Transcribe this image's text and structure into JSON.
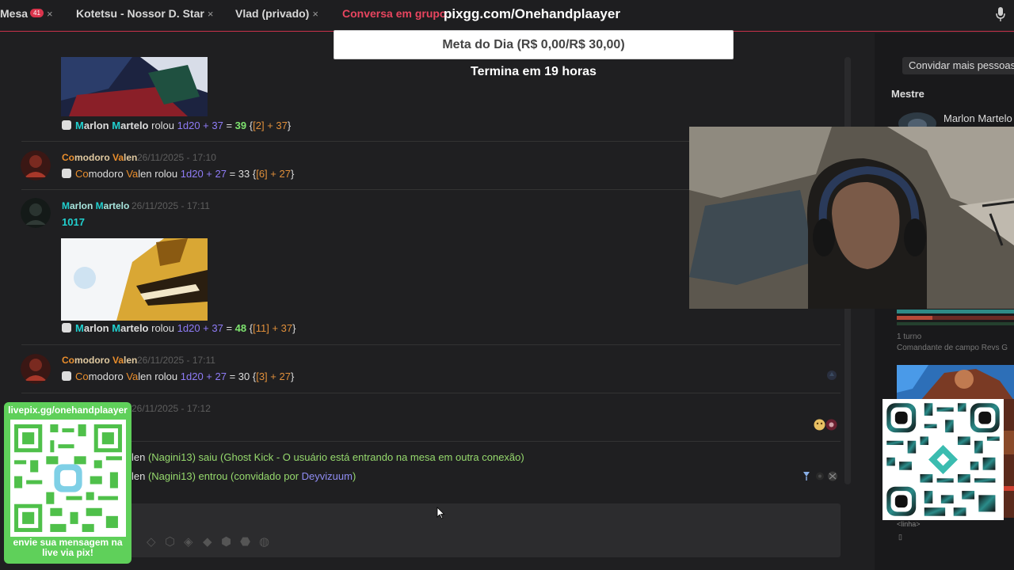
{
  "tabs": [
    {
      "label": "Mesa",
      "badge": "41",
      "close": "×"
    },
    {
      "label": "Kotetsu - Nossor D. Star",
      "close": "×"
    },
    {
      "label": "Vlad (privado)",
      "close": "×"
    },
    {
      "label": "Conversa em grupo",
      "close": ""
    }
  ],
  "overlay": {
    "pix_url": "pixgg.com/Onehandplaayer",
    "goal": "Meta do Dia (R$ 0,00/R$ 30,00)",
    "goal_ends": "Termina em 19 horas"
  },
  "messages": {
    "m1": {
      "roll_user_a": "M",
      "roll_user_b": "arlon ",
      "roll_user_c": "M",
      "roll_user_d": "artelo",
      "rolled": " rolou ",
      "dice": "1d20 + 37",
      "eq": " = ",
      "result": "39",
      "brace_open": " {",
      "bracket": "[2]",
      "plus": " + 37",
      "brace_close": "}"
    },
    "m2": {
      "user_a": "Co",
      "user_b": "modoro ",
      "user_c": "Va",
      "user_d": "len",
      "timestamp": "26/11/2025 - 17:10",
      "dice": "1d20 + 27",
      "eq": " = 33 {",
      "bracket": "[6]",
      "plus": " + 27",
      "brace_close": "}"
    },
    "m3": {
      "user_a": "M",
      "user_b": "arlon ",
      "user_c": "M",
      "user_d": "artelo",
      "timestamp": "26/11/2025 - 17:11",
      "text": "1017",
      "dice": "1d20 + 37",
      "eq": " = ",
      "result": "48",
      "brace_open": " {",
      "bracket": "[11]",
      "plus": " + 37",
      "brace_close": "}"
    },
    "m4": {
      "user_a": "Co",
      "user_b": "modoro ",
      "user_c": "Va",
      "user_d": "len",
      "timestamp": "26/11/2025 - 17:11",
      "dice": "1d20 + 27",
      "eq": " = 30 {",
      "bracket": "[3]",
      "plus": " + 27",
      "brace_close": "}"
    },
    "m5": {
      "timestamp": "26/11/2025 - 17:12"
    },
    "sys1": {
      "prefix": "len ",
      "user": "(Nagini13) saiu",
      "rest": " (Ghost Kick - O usuário está entrando na mesa em outra conexão)"
    },
    "sys2": {
      "prefix": "len ",
      "user": "(Nagini13) entrou (convidado por ",
      "inviter": "Deyvizuum",
      "end": ")"
    }
  },
  "right_panel": {
    "invite_button": "Convidar mais pessoas",
    "mestre_label": "Mestre",
    "mestre_name": "Marlon Martelo",
    "turn": "1 turno",
    "commander": "Comandante de campo Revs G",
    "linha": "<linha>",
    "small_glyph": "▯"
  },
  "qr_left": {
    "top": "livepix.gg/onehandplaayer",
    "bottom_1": "envie sua mensagem na",
    "bottom_2": "live via pix!"
  },
  "colors": {
    "accent": "#e8455f",
    "qr_green": "#5fd05a",
    "teal_name": "#21d0cf",
    "orange_name": "#ea8e2c"
  }
}
